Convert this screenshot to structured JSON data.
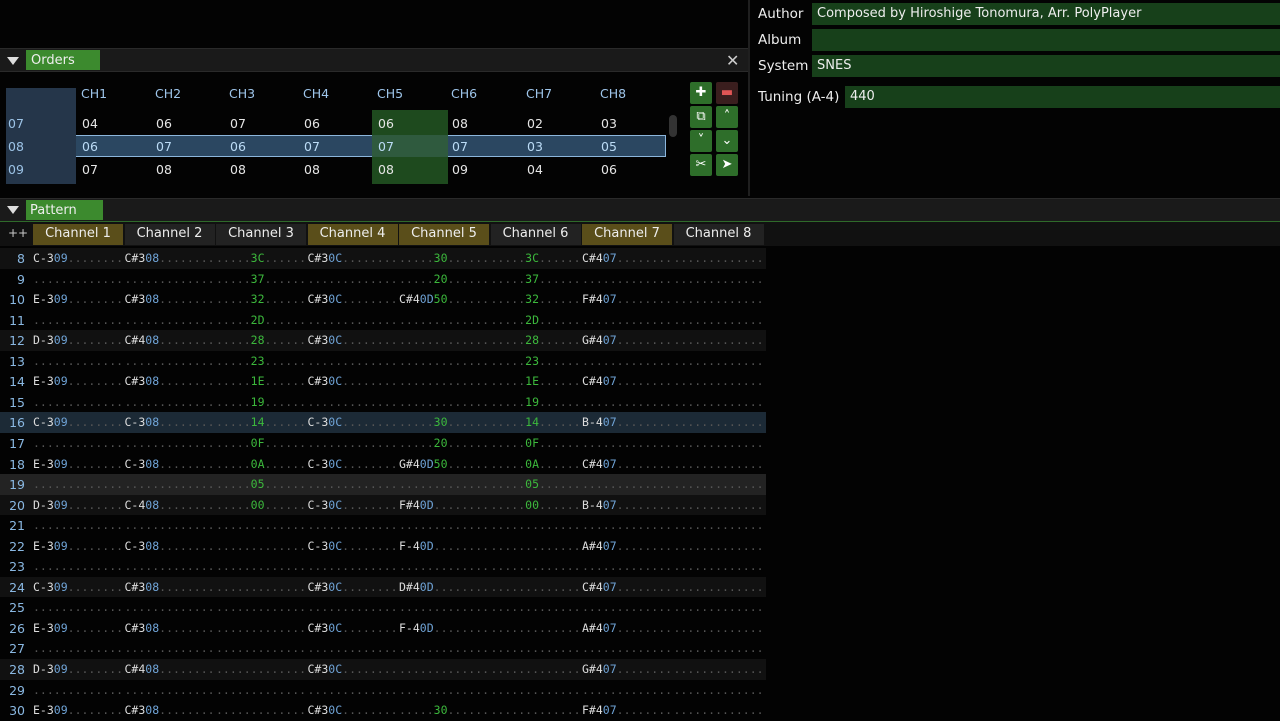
{
  "orders": {
    "title": "Orders",
    "headers": [
      "CH1",
      "CH2",
      "CH3",
      "CH4",
      "CH5",
      "CH6",
      "CH7",
      "CH8"
    ],
    "rows": [
      {
        "idx": "07",
        "vals": [
          "04",
          "06",
          "07",
          "06",
          "06",
          "08",
          "02",
          "03"
        ]
      },
      {
        "idx": "08",
        "vals": [
          "06",
          "07",
          "06",
          "07",
          "07",
          "07",
          "03",
          "05"
        ]
      },
      {
        "idx": "09",
        "vals": [
          "07",
          "08",
          "08",
          "08",
          "08",
          "09",
          "04",
          "06"
        ]
      }
    ]
  },
  "info": {
    "author_label": "Author",
    "author": "Composed by Hiroshige Tonomura, Arr. PolyPlayer",
    "album_label": "Album",
    "album": "",
    "system_label": "System",
    "system": "SNES",
    "tuning_label": "Tuning (A-4)",
    "tuning": "440"
  },
  "pattern": {
    "title": "Pattern",
    "corner": "++",
    "channels": [
      "Channel 1",
      "Channel 2",
      "Channel 3",
      "Channel 4",
      "Channel 5",
      "Channel 6",
      "Channel 7",
      "Channel 8"
    ],
    "rows": [
      {
        "n": "8",
        "c": [
          [
            "C-3",
            "09",
            ""
          ],
          [
            "C#3",
            "08",
            ""
          ],
          [
            "",
            "",
            "3C"
          ],
          [
            "C#3",
            "0C",
            ""
          ],
          [
            "",
            "",
            "30"
          ],
          [
            "",
            "",
            "3C"
          ],
          [
            "C#4",
            "07",
            ""
          ],
          [
            "",
            "",
            ""
          ]
        ]
      },
      {
        "n": "9",
        "c": [
          [
            "",
            "",
            ""
          ],
          [
            "",
            "",
            ""
          ],
          [
            "",
            "",
            "37"
          ],
          [
            "",
            "",
            ""
          ],
          [
            "",
            "",
            "20"
          ],
          [
            "",
            "",
            "37"
          ],
          [
            "",
            "",
            ""
          ],
          [
            "",
            "",
            ""
          ]
        ]
      },
      {
        "n": "10",
        "c": [
          [
            "E-3",
            "09",
            ""
          ],
          [
            "C#3",
            "08",
            ""
          ],
          [
            "",
            "",
            "32"
          ],
          [
            "C#3",
            "0C",
            ""
          ],
          [
            "C#4",
            "0D",
            "50"
          ],
          [
            "",
            "",
            "32"
          ],
          [
            "F#4",
            "07",
            ""
          ],
          [
            "",
            "",
            ""
          ]
        ]
      },
      {
        "n": "11",
        "c": [
          [
            "",
            "",
            ""
          ],
          [
            "",
            "",
            ""
          ],
          [
            "",
            "",
            "2D"
          ],
          [
            "",
            "",
            ""
          ],
          [
            "",
            "",
            ""
          ],
          [
            "",
            "",
            "2D"
          ],
          [
            "",
            "",
            ""
          ],
          [
            "",
            "",
            ""
          ]
        ]
      },
      {
        "n": "12",
        "c": [
          [
            "D-3",
            "09",
            ""
          ],
          [
            "C#4",
            "08",
            ""
          ],
          [
            "",
            "",
            "28"
          ],
          [
            "C#3",
            "0C",
            ""
          ],
          [
            "",
            "",
            ""
          ],
          [
            "",
            "",
            "28"
          ],
          [
            "G#4",
            "07",
            ""
          ],
          [
            "",
            "",
            ""
          ]
        ]
      },
      {
        "n": "13",
        "c": [
          [
            "",
            "",
            ""
          ],
          [
            "",
            "",
            ""
          ],
          [
            "",
            "",
            "23"
          ],
          [
            "",
            "",
            ""
          ],
          [
            "",
            "",
            ""
          ],
          [
            "",
            "",
            "23"
          ],
          [
            "",
            "",
            ""
          ],
          [
            "",
            "",
            ""
          ]
        ]
      },
      {
        "n": "14",
        "c": [
          [
            "E-3",
            "09",
            ""
          ],
          [
            "C#3",
            "08",
            ""
          ],
          [
            "",
            "",
            "1E"
          ],
          [
            "C#3",
            "0C",
            ""
          ],
          [
            "",
            "",
            ""
          ],
          [
            "",
            "",
            "1E"
          ],
          [
            "C#4",
            "07",
            ""
          ],
          [
            "",
            "",
            ""
          ]
        ]
      },
      {
        "n": "15",
        "c": [
          [
            "",
            "",
            ""
          ],
          [
            "",
            "",
            ""
          ],
          [
            "",
            "",
            "19"
          ],
          [
            "",
            "",
            ""
          ],
          [
            "",
            "",
            ""
          ],
          [
            "",
            "",
            "19"
          ],
          [
            "",
            "",
            ""
          ],
          [
            "",
            "",
            ""
          ]
        ]
      },
      {
        "n": "16",
        "c": [
          [
            "C-3",
            "09",
            ""
          ],
          [
            "C-3",
            "08",
            ""
          ],
          [
            "",
            "",
            "14"
          ],
          [
            "C-3",
            "0C",
            ""
          ],
          [
            "",
            "",
            "30"
          ],
          [
            "",
            "",
            "14"
          ],
          [
            "B-4",
            "07",
            ""
          ],
          [
            "",
            "",
            ""
          ]
        ]
      },
      {
        "n": "17",
        "c": [
          [
            "",
            "",
            ""
          ],
          [
            "",
            "",
            ""
          ],
          [
            "",
            "",
            "0F"
          ],
          [
            "",
            "",
            ""
          ],
          [
            "",
            "",
            "20"
          ],
          [
            "",
            "",
            "0F"
          ],
          [
            "",
            "",
            ""
          ],
          [
            "",
            "",
            ""
          ]
        ]
      },
      {
        "n": "18",
        "c": [
          [
            "E-3",
            "09",
            ""
          ],
          [
            "C-3",
            "08",
            ""
          ],
          [
            "",
            "",
            "0A"
          ],
          [
            "C-3",
            "0C",
            ""
          ],
          [
            "G#4",
            "0D",
            "50"
          ],
          [
            "",
            "",
            "0A"
          ],
          [
            "C#4",
            "07",
            ""
          ],
          [
            "",
            "",
            ""
          ]
        ]
      },
      {
        "n": "19",
        "c": [
          [
            "",
            "",
            ""
          ],
          [
            "",
            "",
            ""
          ],
          [
            "",
            "",
            "05"
          ],
          [
            "",
            "",
            ""
          ],
          [
            "",
            "",
            ""
          ],
          [
            "",
            "",
            "05"
          ],
          [
            "",
            "",
            ""
          ],
          [
            "",
            "",
            ""
          ]
        ]
      },
      {
        "n": "20",
        "c": [
          [
            "D-3",
            "09",
            ""
          ],
          [
            "C-4",
            "08",
            ""
          ],
          [
            "",
            "",
            "00"
          ],
          [
            "C-3",
            "0C",
            ""
          ],
          [
            "F#4",
            "0D",
            ""
          ],
          [
            "",
            "",
            "00"
          ],
          [
            "B-4",
            "07",
            ""
          ],
          [
            "",
            "",
            ""
          ]
        ]
      },
      {
        "n": "21",
        "c": [
          [
            "",
            "",
            ""
          ],
          [
            "",
            "",
            ""
          ],
          [
            "",
            "",
            ""
          ],
          [
            "",
            "",
            ""
          ],
          [
            "",
            "",
            ""
          ],
          [
            "",
            "",
            ""
          ],
          [
            "",
            "",
            ""
          ],
          [
            "",
            "",
            ""
          ]
        ]
      },
      {
        "n": "22",
        "c": [
          [
            "E-3",
            "09",
            ""
          ],
          [
            "C-3",
            "08",
            ""
          ],
          [
            "",
            "",
            ""
          ],
          [
            "C-3",
            "0C",
            ""
          ],
          [
            "F-4",
            "0D",
            ""
          ],
          [
            "",
            "",
            ""
          ],
          [
            "A#4",
            "07",
            ""
          ],
          [
            "",
            "",
            ""
          ]
        ]
      },
      {
        "n": "23",
        "c": [
          [
            "",
            "",
            ""
          ],
          [
            "",
            "",
            ""
          ],
          [
            "",
            "",
            ""
          ],
          [
            "",
            "",
            ""
          ],
          [
            "",
            "",
            ""
          ],
          [
            "",
            "",
            ""
          ],
          [
            "",
            "",
            ""
          ],
          [
            "",
            "",
            ""
          ]
        ]
      },
      {
        "n": "24",
        "c": [
          [
            "C-3",
            "09",
            ""
          ],
          [
            "C#3",
            "08",
            ""
          ],
          [
            "",
            "",
            ""
          ],
          [
            "C#3",
            "0C",
            ""
          ],
          [
            "D#4",
            "0D",
            ""
          ],
          [
            "",
            "",
            ""
          ],
          [
            "C#4",
            "07",
            ""
          ],
          [
            "",
            "",
            ""
          ]
        ]
      },
      {
        "n": "25",
        "c": [
          [
            "",
            "",
            ""
          ],
          [
            "",
            "",
            ""
          ],
          [
            "",
            "",
            ""
          ],
          [
            "",
            "",
            ""
          ],
          [
            "",
            "",
            ""
          ],
          [
            "",
            "",
            ""
          ],
          [
            "",
            "",
            ""
          ],
          [
            "",
            "",
            ""
          ]
        ]
      },
      {
        "n": "26",
        "c": [
          [
            "E-3",
            "09",
            ""
          ],
          [
            "C#3",
            "08",
            ""
          ],
          [
            "",
            "",
            ""
          ],
          [
            "C#3",
            "0C",
            ""
          ],
          [
            "F-4",
            "0D",
            ""
          ],
          [
            "",
            "",
            ""
          ],
          [
            "A#4",
            "07",
            ""
          ],
          [
            "",
            "",
            ""
          ]
        ]
      },
      {
        "n": "27",
        "c": [
          [
            "",
            "",
            ""
          ],
          [
            "",
            "",
            ""
          ],
          [
            "",
            "",
            ""
          ],
          [
            "",
            "",
            ""
          ],
          [
            "",
            "",
            ""
          ],
          [
            "",
            "",
            ""
          ],
          [
            "",
            "",
            ""
          ],
          [
            "",
            "",
            ""
          ]
        ]
      },
      {
        "n": "28",
        "c": [
          [
            "D-3",
            "09",
            ""
          ],
          [
            "C#4",
            "08",
            ""
          ],
          [
            "",
            "",
            ""
          ],
          [
            "C#3",
            "0C",
            ""
          ],
          [
            "",
            "",
            ""
          ],
          [
            "",
            "",
            ""
          ],
          [
            "G#4",
            "07",
            ""
          ],
          [
            "",
            "",
            ""
          ]
        ]
      },
      {
        "n": "29",
        "c": [
          [
            "",
            "",
            ""
          ],
          [
            "",
            "",
            ""
          ],
          [
            "",
            "",
            ""
          ],
          [
            "",
            "",
            ""
          ],
          [
            "",
            "",
            ""
          ],
          [
            "",
            "",
            ""
          ],
          [
            "",
            "",
            ""
          ],
          [
            "",
            "",
            ""
          ]
        ]
      },
      {
        "n": "30",
        "c": [
          [
            "E-3",
            "09",
            ""
          ],
          [
            "C#3",
            "08",
            ""
          ],
          [
            "",
            "",
            ""
          ],
          [
            "C#3",
            "0C",
            ""
          ],
          [
            "",
            "",
            "30"
          ],
          [
            "",
            "",
            ""
          ],
          [
            "F#4",
            "07",
            ""
          ],
          [
            "",
            "",
            ""
          ]
        ]
      }
    ]
  }
}
